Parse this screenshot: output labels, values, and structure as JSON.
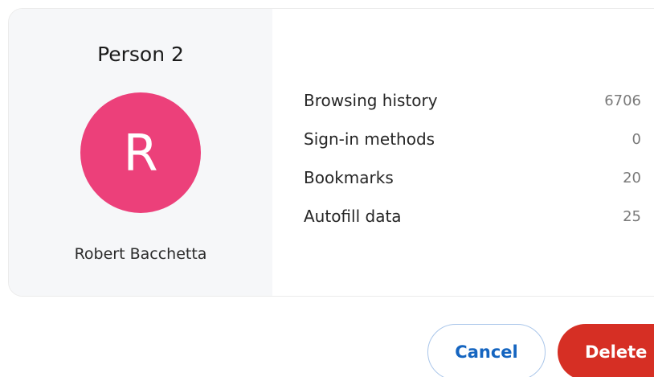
{
  "profile": {
    "title": "Person 2",
    "avatar_letter": "R",
    "account_name": "Robert Bacchetta"
  },
  "stats": [
    {
      "label": "Browsing history",
      "value": "6706"
    },
    {
      "label": "Sign-in methods",
      "value": "0"
    },
    {
      "label": "Bookmarks",
      "value": "20"
    },
    {
      "label": "Autofill data",
      "value": "25"
    }
  ],
  "actions": {
    "cancel_label": "Cancel",
    "delete_label": "Delete"
  },
  "colors": {
    "avatar": "#ec407a",
    "delete_button": "#d62f24",
    "cancel_text": "#1565c0"
  }
}
